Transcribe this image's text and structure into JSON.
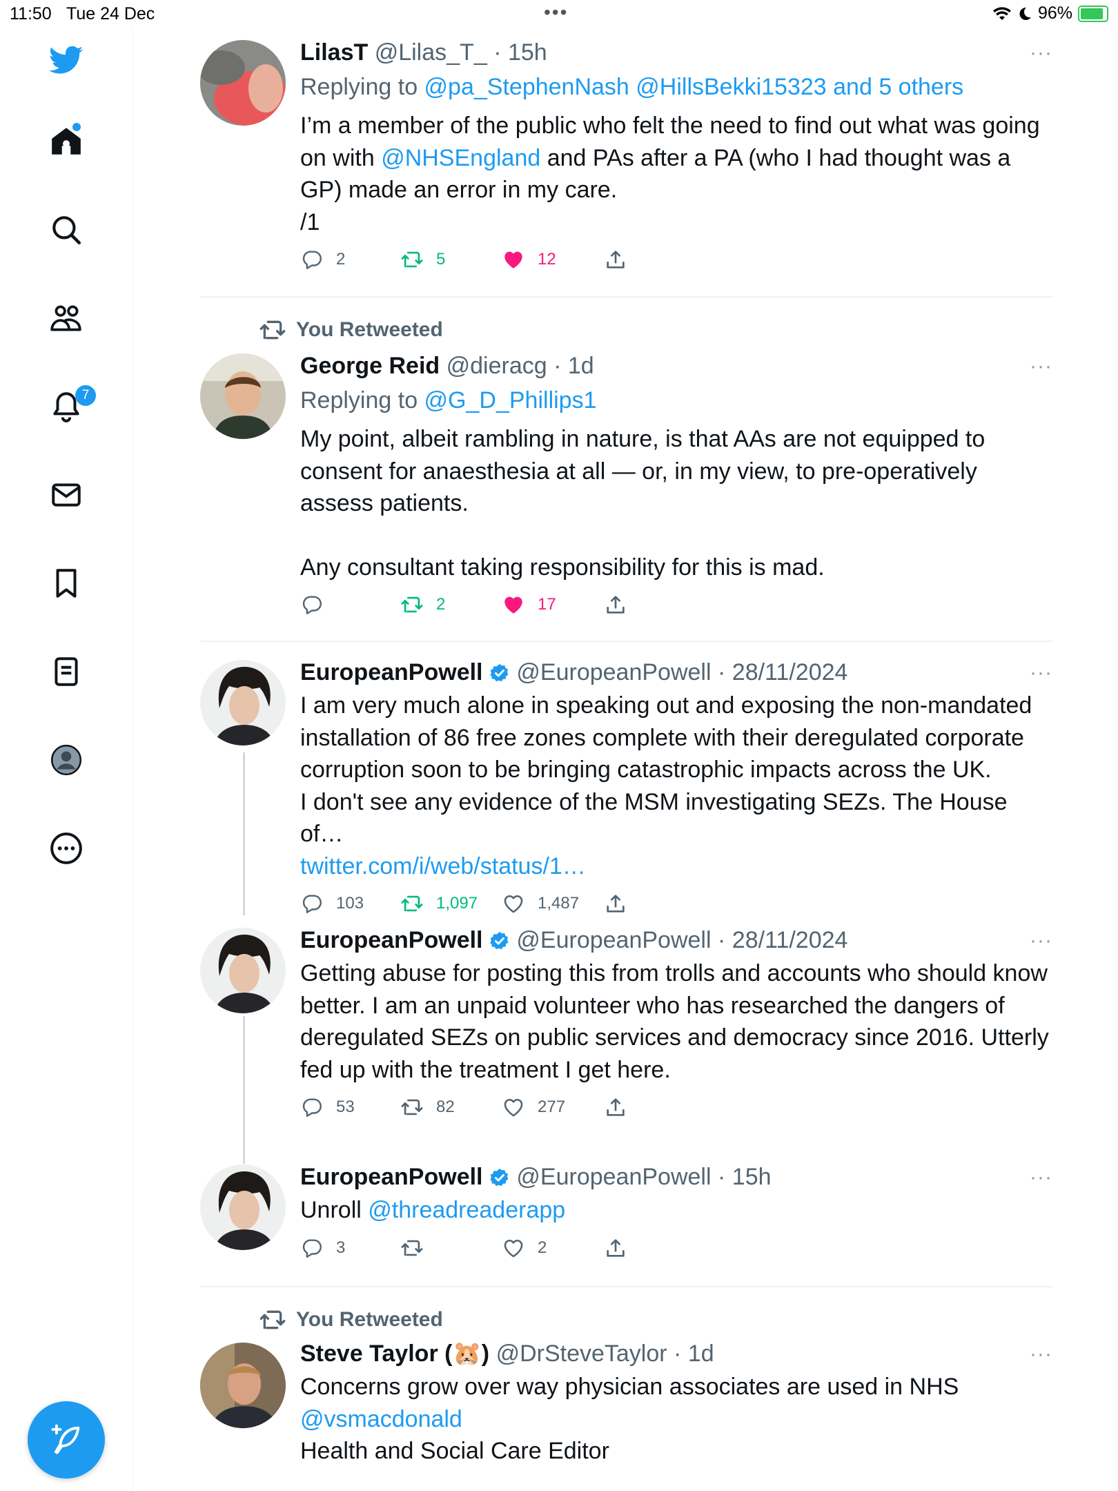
{
  "status_bar": {
    "time": "11:50",
    "date": "Tue 24 Dec",
    "battery": "96%"
  },
  "sidebar": {
    "notifications_badge": "7"
  },
  "tweets": [
    {
      "name": "LilasT",
      "handle": "@Lilas_T_",
      "sep": "·",
      "time": "15h",
      "replying_prefix": "Replying to ",
      "replying_to": "@pa_StephenNash @HillsBekki15323 and 5 others",
      "body_1": "I’m a member of the public who felt the need to find out what was going on with ",
      "mention": "@NHSEngland",
      "body_2": " and PAs after a PA (who I had thought was a GP) made an error in my care.",
      "body_3": "/1",
      "replies": "2",
      "retweets": "5",
      "likes": "12"
    },
    {
      "retweeted_label": "You Retweeted",
      "name": "George Reid",
      "handle": "@dieracg",
      "sep": "·",
      "time": "1d",
      "replying_prefix": "Replying to ",
      "replying_to": "@G_D_Phillips1",
      "body_1": "My point, albeit rambling in nature, is that AAs are not equipped to consent for anaesthesia at all — or, in my view, to pre-operatively assess patients.",
      "body_2": "Any consultant taking responsibility for this is mad.",
      "replies": "",
      "retweets": "2",
      "likes": "17"
    },
    {
      "name": "EuropeanPowell",
      "handle": "@EuropeanPowell",
      "sep": "·",
      "time": "28/11/2024",
      "body_1": "I am very much alone in speaking out and exposing the non-mandated installation of 86 free zones complete with their deregulated corporate corruption soon to be bringing catastrophic impacts across the UK.",
      "body_2": "I don't see any evidence of the MSM investigating SEZs. The House of…",
      "link": "twitter.com/i/web/status/1…",
      "replies": "103",
      "retweets": "1,097",
      "likes": "1,487"
    },
    {
      "name": "EuropeanPowell",
      "handle": "@EuropeanPowell",
      "sep": "·",
      "time": "28/11/2024",
      "body_1": "Getting abuse for posting this from trolls and accounts who should know better. I am an unpaid volunteer who has researched the dangers of deregulated SEZs on public services and democracy since 2016. Utterly fed up with the treatment I get here.",
      "replies": "53",
      "retweets": "82",
      "likes": "277"
    },
    {
      "name": "EuropeanPowell",
      "handle": "@EuropeanPowell",
      "sep": "·",
      "time": "15h",
      "body_1": "Unroll ",
      "mention": "@threadreaderapp",
      "replies": "3",
      "retweets": "",
      "likes": "2"
    },
    {
      "retweeted_label": "You Retweeted",
      "name": "Steve Taylor (🐹)",
      "handle": "@DrSteveTaylor",
      "sep": "·",
      "time": "1d",
      "body_1": "Concerns grow over way physician associates are used in NHS",
      "mention": "@vsmacdonald",
      "body_2": "Health and Social Care Editor"
    }
  ],
  "more_glyph": "···"
}
